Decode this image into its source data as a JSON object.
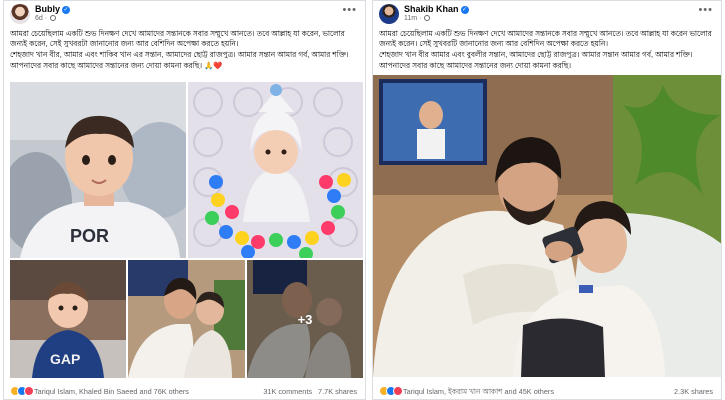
{
  "posts": [
    {
      "author": "Bubly",
      "time": "6d",
      "text": [
        "আমরা চেয়েছিলাম একটি শুভ দিনক্ষণ দেখে আমাদের সন্তানকে সবার সম্মুখে আনতে। তবে আল্লাহ যা করেন, ভালোর জন্যই করেন, সেই সুখবরটা জানানোর জন্য আর বেশিদিন অপেক্ষা করতে হয়নি।",
        "শেহজাদ খান বীর, আমার এবং শাকিব খান এর সন্তান, আমাদের ছোট্ট রাজপুত্র। আমার সন্তান আমার গর্ব, আমার শক্তি। আপনাদের সবার কাছে আমাদের সন্তানের জন্য দোয়া কামনা করছি। 🙏❤️"
      ],
      "more_photos": "+3",
      "reactions": "Tariqul Islam, Khaled Bin Saeed and 76K others",
      "comments": "31K comments",
      "shares": "7.7K shares"
    },
    {
      "author": "Shakib Khan",
      "time": "11m",
      "text": [
        "আমরা চেয়েছিলাম একটি শুভ দিনক্ষণ দেখে আমাদের সন্তানকে সবার সম্মুখে আনতে। তবে আল্লাহ যা করেন ভালোর জন্যই করেন। সেই সুখবরটি জানানোর জন্য আর বেশিদিন অপেক্ষা করতে হয়নি।",
        "শেহজাদ খান বীর আমার এবং বুবলীর সন্তান, আমাদের ছোট্ট রাজপুত্র। আমার সন্তান আমার গর্ব, আমার শক্তি। আপনাদের সবার কাছে আমাদের সন্তানের জন্য দোয়া কামনা করছি।"
      ],
      "reactions": "Tariqul Islam, ইকরাম খান আকাশ and 45K others",
      "shares": "2.3K shares"
    }
  ],
  "icons": {
    "verified": "verified-badge-icon",
    "audience": "globe-icon",
    "menu": "more-options-icon",
    "reactions": [
      "haha-reaction-icon",
      "like-reaction-icon",
      "love-reaction-icon"
    ]
  },
  "colors": {
    "brand_blue": "#1877f2",
    "love_red": "#f33e58",
    "haha_yellow": "#f7b125",
    "secondary_text": "#65676b"
  }
}
